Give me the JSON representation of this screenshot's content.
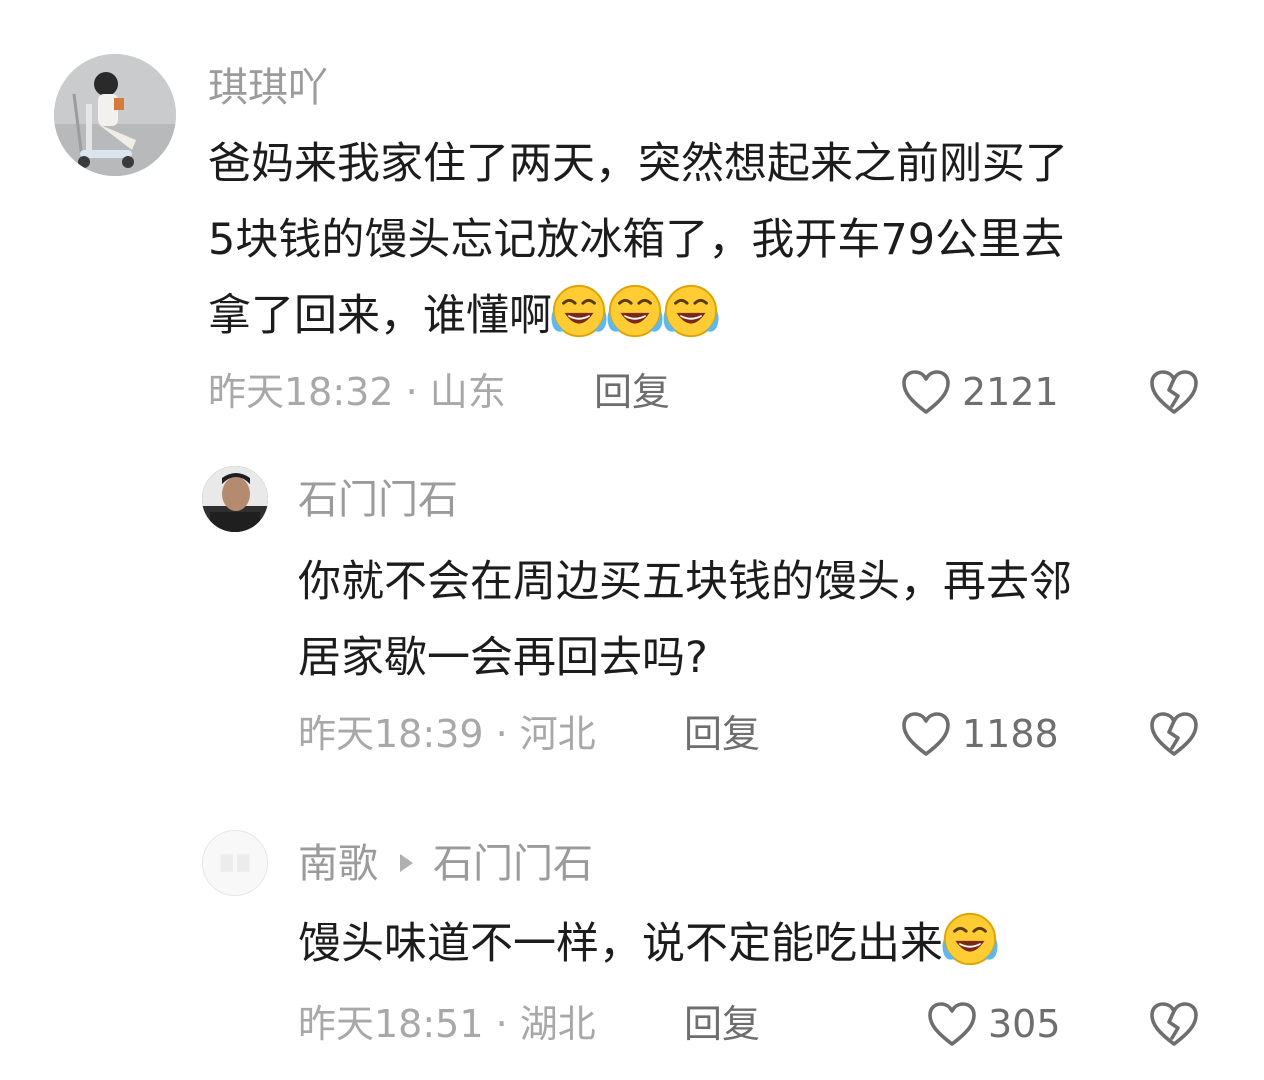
{
  "comments": [
    {
      "username": "琪琪吖",
      "lines": [
        "爸妈来我家住了两天，突然想起来之前刚买了",
        "5块钱的馒头忘记放冰箱了，我开车79公里去",
        "拿了回来，谁懂啊"
      ],
      "trailing_emoji": "laughing-crying-emoji x3",
      "time": "昨天18:32 · 山东",
      "reply_label": "回复",
      "likes": "2121"
    },
    {
      "username": "石门门石",
      "lines": [
        "你就不会在周边买五块钱的馒头，再去邻",
        "居家歇一会再回去吗?"
      ],
      "time": "昨天18:39 · 河北",
      "reply_label": "回复",
      "likes": "1188"
    },
    {
      "username": "南歌",
      "reply_to": "石门门石",
      "lines": [
        "馒头味道不一样，说不定能吃出来"
      ],
      "trailing_emoji": "laughing-crying-emoji x1",
      "time": "昨天18:51 · 湖北",
      "reply_label": "回复",
      "likes": "305"
    }
  ],
  "icons": {
    "like": "heart-outline-icon",
    "dislike": "broken-heart-icon",
    "emoji": "face-with-tears-of-joy"
  },
  "colors": {
    "username": "#9b9b9b",
    "content": "#1c1c1c",
    "meta": "#a8a8a8",
    "action": "#6e6e6e"
  }
}
